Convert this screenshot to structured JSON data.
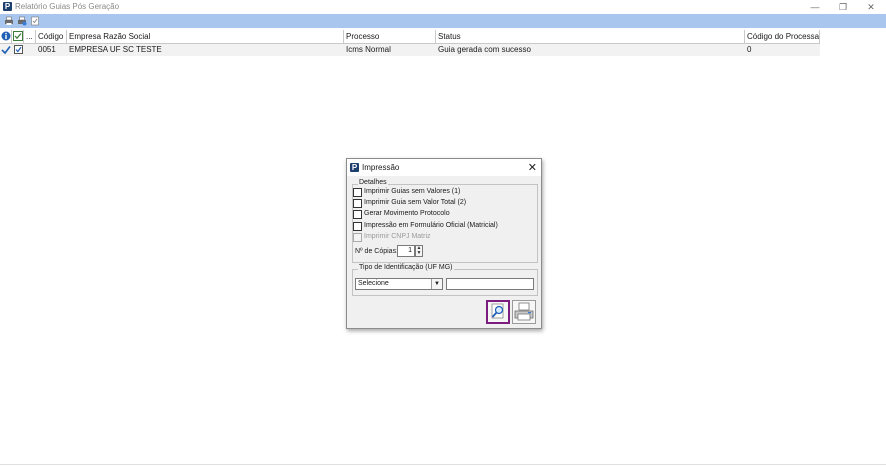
{
  "window": {
    "title": "Relatório Guias Pós Geração",
    "logo_letter": "P",
    "minimize": "—",
    "restore": "❐",
    "close": "✕"
  },
  "toolbar": {
    "icons": [
      "printer-icon",
      "printer-settings-icon",
      "checklist-icon"
    ]
  },
  "grid": {
    "columns": [
      "Código",
      "Empresa Razão Social",
      "Processo",
      "Status",
      "Código do Processa..."
    ],
    "ellipsis_column": "...",
    "rows": [
      {
        "codigo": "0051",
        "empresa": "EMPRESA UF SC TESTE",
        "processo": "Icms Normal",
        "status": "Guia gerada com sucesso",
        "codigo_processo": "0"
      }
    ]
  },
  "dialog": {
    "title": "Impressão",
    "logo_letter": "P",
    "close": "✕",
    "details_group": "Detalhes",
    "options": [
      {
        "label": "Imprimir Guias sem Valores     (1)",
        "checked": false,
        "enabled": true
      },
      {
        "label": "Imprimir Guia sem Valor Total (2)",
        "checked": false,
        "enabled": true
      },
      {
        "label": "Gerar Movimento Protocolo",
        "checked": false,
        "enabled": true
      },
      {
        "label": "Impressão em Formulário Oficial (Matricial)",
        "checked": false,
        "enabled": true
      },
      {
        "label": "Imprimir CNPJ Matriz",
        "checked": false,
        "enabled": false
      }
    ],
    "copies_label": "Nº de Cópias:",
    "copies_value": "1",
    "spin_up": "▲",
    "spin_down": "▼",
    "identification_group": "Tipo de Identificação (UF MG)",
    "select_value": "Selecione",
    "select_arrow": "▼",
    "text_value": ""
  },
  "colors": {
    "toolbar": "#a9c6ee",
    "accent_border": "#7b1d7e",
    "check_blue": "#1f5fb4"
  }
}
